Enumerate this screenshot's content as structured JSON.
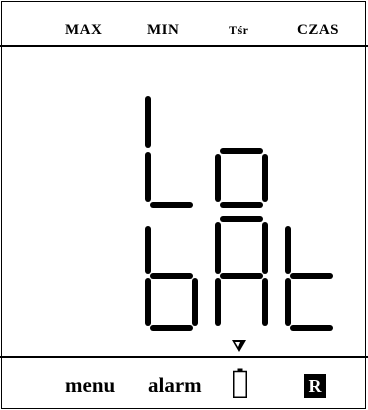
{
  "header": {
    "max_label": "MAX",
    "min_label": "MIN",
    "tsr_label": "Tśr",
    "czas_label": "CZAS"
  },
  "display": {
    "line1": "Lo",
    "line2": "bAt"
  },
  "footer": {
    "menu_label": "menu",
    "alarm_label": "alarm",
    "r_label": "R",
    "battery_icon": "battery-icon",
    "cursor_icon": "triangle-down-icon"
  }
}
